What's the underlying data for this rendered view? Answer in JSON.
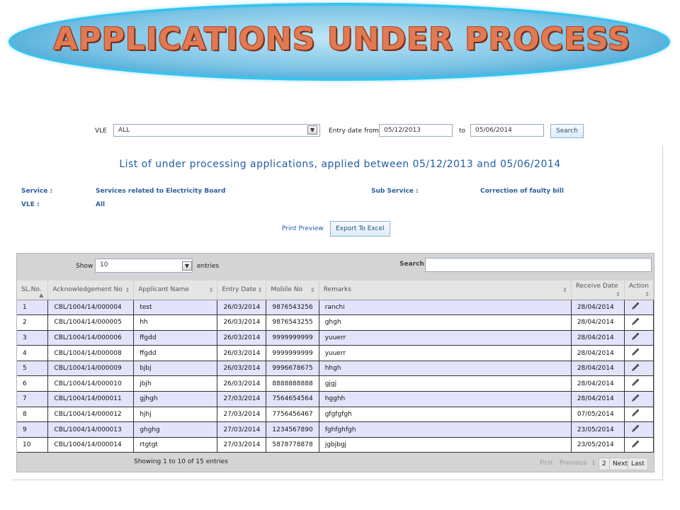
{
  "banner": {
    "title": "APPLICATIONS UNDER PROCESS"
  },
  "filters": {
    "vle_label": "VLE",
    "vle_value": "ALL",
    "entry_date_from_label": "Entry date from",
    "date_from": "05/12/2013",
    "to_label": "to",
    "date_to": "05/06/2014",
    "search_button": "Search"
  },
  "heading": "List of under processing applications, applied between 05/12/2013 and 05/06/2014",
  "info": {
    "service_label": "Service :",
    "service_value": "Services related to Electricity Board",
    "sub_service_label": "Sub Service :",
    "sub_service_value": "Correction of faulty bill",
    "vle_label": "VLE :",
    "vle_value": "All"
  },
  "actions": {
    "print_preview": "Print Preview",
    "export_excel": "Export To Excel"
  },
  "table": {
    "show_label": "Show",
    "page_size": "10",
    "entries_label": "entries",
    "search_label": "Search:",
    "search_value": "",
    "columns": [
      "SL.No.",
      "Acknowledgement No",
      "Applicant Name",
      "Entry Date",
      "Mobile No",
      "Remarks",
      "Receive Date",
      "Action"
    ],
    "rows": [
      [
        "1",
        "CBL/1004/14/000004",
        "test",
        "26/03/2014",
        "9876543256",
        "ranchi",
        "28/04/2014"
      ],
      [
        "2",
        "CBL/1004/14/000005",
        "hh",
        "26/03/2014",
        "9876543255",
        "ghgh",
        "28/04/2014"
      ],
      [
        "3",
        "CBL/1004/14/000006",
        "ffgdd",
        "26/03/2014",
        "9999999999",
        "yuuerr",
        "28/04/2014"
      ],
      [
        "4",
        "CBL/1004/14/000008",
        "ffgdd",
        "26/03/2014",
        "9999999999",
        "yuuerr",
        "28/04/2014"
      ],
      [
        "5",
        "CBL/1004/14/000009",
        "bjbj",
        "26/03/2014",
        "9996678675",
        "hhgh",
        "28/04/2014"
      ],
      [
        "6",
        "CBL/1004/14/000010",
        "jbjh",
        "26/03/2014",
        "8888888888",
        "gjgj",
        "28/04/2014"
      ],
      [
        "7",
        "CBL/1004/14/000011",
        "gjhgh",
        "27/03/2014",
        "7564654564",
        "hgghh",
        "28/04/2014"
      ],
      [
        "8",
        "CBL/1004/14/000012",
        "hjhj",
        "27/03/2014",
        "7756456467",
        "gfgfgfgh",
        "07/05/2014"
      ],
      [
        "9",
        "CBL/1004/14/000013",
        "ghghg",
        "27/03/2014",
        "1234567890",
        "fghfghfgh",
        "23/05/2014"
      ],
      [
        "10",
        "CBL/1004/14/000014",
        "rtgtgt",
        "27/03/2014",
        "5878778878",
        "jgbjbgj",
        "23/05/2014"
      ]
    ],
    "footer_info": "Showing 1 to 10 of 15 entries",
    "pagination": {
      "first": "First",
      "previous": "Previous",
      "page1": "1",
      "page2": "2",
      "next": "Next",
      "last": "Last"
    }
  },
  "icons": {
    "row_action": "pencil-icon",
    "dropdown": "chevron-down-icon",
    "sort": "sort-icon"
  }
}
